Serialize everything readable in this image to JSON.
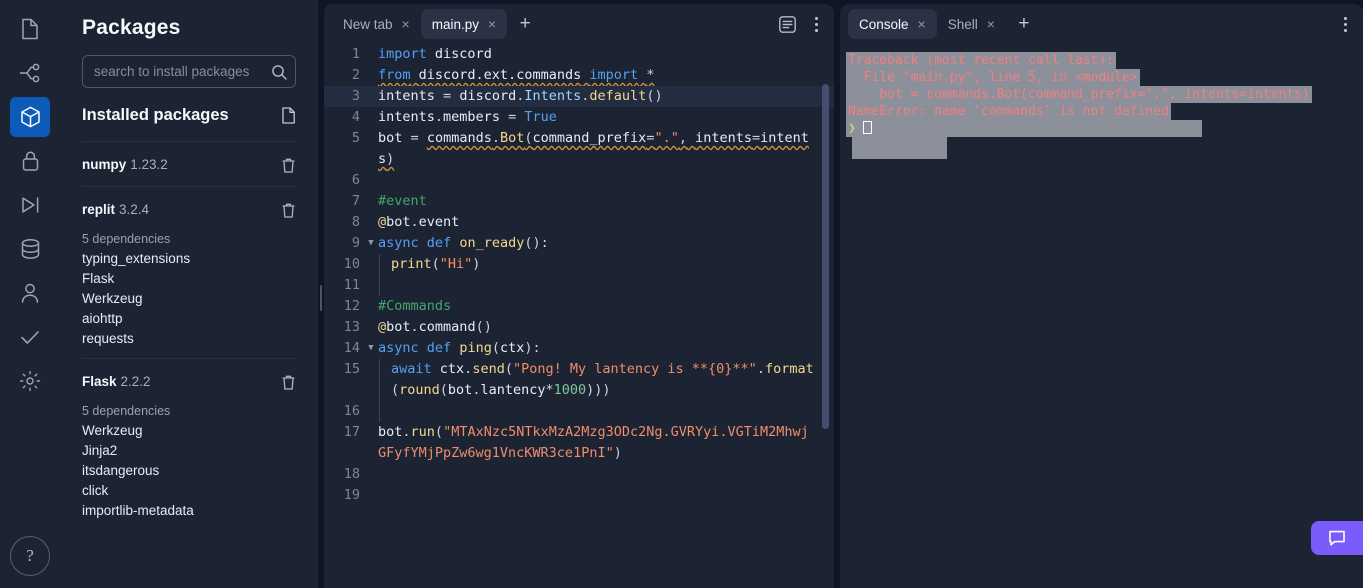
{
  "rail": {
    "items": [
      {
        "name": "files-icon",
        "label": "Files"
      },
      {
        "name": "git-branch-icon",
        "label": "Version control"
      },
      {
        "name": "packages-icon",
        "label": "Packages",
        "active": true
      },
      {
        "name": "lock-icon",
        "label": "Secrets"
      },
      {
        "name": "debugger-icon",
        "label": "Debugger"
      },
      {
        "name": "database-icon",
        "label": "Database"
      },
      {
        "name": "user-icon",
        "label": "Authentication"
      },
      {
        "name": "check-icon",
        "label": "Unit tests"
      },
      {
        "name": "gear-icon",
        "label": "Settings"
      }
    ],
    "help_label": "?"
  },
  "sidebar": {
    "title": "Packages",
    "search": {
      "placeholder": "search to install packages",
      "value": "",
      "icon": "search-icon"
    },
    "installed_header": "Installed packages",
    "installed_header_icon": "file-icon",
    "packages": [
      {
        "name": "numpy",
        "version": "1.23.2",
        "deps_label": "",
        "deps": []
      },
      {
        "name": "replit",
        "version": "3.2.4",
        "deps_label": "5 dependencies",
        "deps": [
          "typing_extensions",
          "Flask",
          "Werkzeug",
          "aiohttp",
          "requests"
        ]
      },
      {
        "name": "Flask",
        "version": "2.2.2",
        "deps_label": "5 dependencies",
        "deps": [
          "Werkzeug",
          "Jinja2",
          "itsdangerous",
          "click",
          "importlib-metadata"
        ]
      }
    ],
    "delete_icon": "trash-icon"
  },
  "editor": {
    "tabs": [
      {
        "label": "New tab",
        "active": false,
        "close": "×"
      },
      {
        "label": "main.py",
        "active": true,
        "close": "×"
      }
    ],
    "new_tab_plus": "+",
    "format_icon": "format-document-icon",
    "menu_icon": "kebab-menu-icon",
    "lines": [
      {
        "n": "1",
        "fold": "",
        "highlight": false
      },
      {
        "n": "2",
        "fold": "",
        "highlight": false
      },
      {
        "n": "3",
        "fold": "",
        "highlight": true
      },
      {
        "n": "4",
        "fold": "",
        "highlight": false
      },
      {
        "n": "5",
        "fold": "",
        "highlight": false
      },
      {
        "n": "6",
        "fold": "",
        "highlight": false
      },
      {
        "n": "7",
        "fold": "",
        "highlight": false
      },
      {
        "n": "8",
        "fold": "",
        "highlight": false
      },
      {
        "n": "9",
        "fold": "▼",
        "highlight": false
      },
      {
        "n": "10",
        "fold": "",
        "highlight": false
      },
      {
        "n": "11",
        "fold": "",
        "highlight": false
      },
      {
        "n": "12",
        "fold": "",
        "highlight": false
      },
      {
        "n": "13",
        "fold": "",
        "highlight": false
      },
      {
        "n": "14",
        "fold": "▼",
        "highlight": false
      },
      {
        "n": "15",
        "fold": "",
        "highlight": false
      },
      {
        "n": "16",
        "fold": "",
        "highlight": false
      },
      {
        "n": "17",
        "fold": "",
        "highlight": false
      },
      {
        "n": "18",
        "fold": "",
        "highlight": false
      },
      {
        "n": "19",
        "fold": "",
        "highlight": false
      }
    ],
    "code_text": {
      "l1_import": "import",
      "l1_mod": "discord",
      "l2_from": "from",
      "l2_path": "discord.ext.commands",
      "l2_import": "import",
      "l2_star": "*",
      "l3": "intents = discord.Intents.default()",
      "l4": "intents.members = True",
      "l5": "bot = commands.Bot(command_prefix=\".\", intents=intents)",
      "l7": "#event",
      "l8": "@bot.event",
      "l9": "async def on_ready():",
      "l10": "print(\"Hi\")",
      "l12": "#Commands",
      "l13": "@bot.command()",
      "l14": "async def ping(ctx):",
      "l15": "await ctx.send(\"Pong! My lantency is **{0}**\".format(round(bot.lantency*1000)))",
      "l17": "bot.run(\"MTAxNzc5NTkxMzA2Mzg3ODc2Ng.GVRYyi.VGTiM2MhwjGFyfYMjPpZw6wg1VncKWR3ce1PnI\")"
    }
  },
  "console": {
    "tabs": [
      {
        "label": "Console",
        "active": true,
        "close": "×"
      },
      {
        "label": "Shell",
        "active": false,
        "close": "×"
      }
    ],
    "new_tab_plus": "+",
    "menu_icon": "kebab-menu-icon",
    "output": [
      "Traceback (most recent call last):",
      "  File \"main.py\", line 5, in <module>",
      "    bot = commands.Bot(command_prefix=\".\", intents=intents)",
      "NameError: name 'commands' is not defined"
    ],
    "prompt_symbol": "❯",
    "error_color": "#f08080",
    "selection_color": "#8b909b"
  },
  "chat": {
    "icon": "chat-bubble-icon",
    "accent_color": "#7b5cfa"
  }
}
